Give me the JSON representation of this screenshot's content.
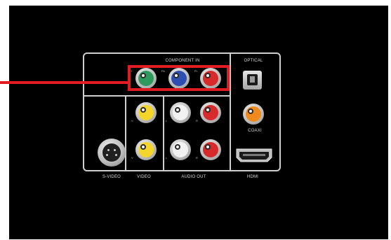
{
  "labels": {
    "component_in": "COMPONENT IN",
    "optical": "OPTICAL",
    "coaxi": "COAXI",
    "s_video": "S-VIDEO",
    "video": "VIDEO",
    "audio_out": "AUDIO OUT",
    "hdmi": "HDMI"
  },
  "pin_labels": {
    "y": "Y",
    "pb": "Pb",
    "pr": "Pr",
    "v1": "V",
    "v2": "V",
    "l1": "L",
    "r1": "R",
    "l2": "L",
    "r2": "R"
  },
  "colors": {
    "highlight": "#e31b23",
    "jack_green": "#2e9a5e",
    "jack_blue": "#2f4fb0",
    "jack_red": "#d72a2a",
    "jack_yellow": "#f3d52b",
    "jack_white": "#f2f2f2",
    "jack_orange": "#f08a1c"
  }
}
